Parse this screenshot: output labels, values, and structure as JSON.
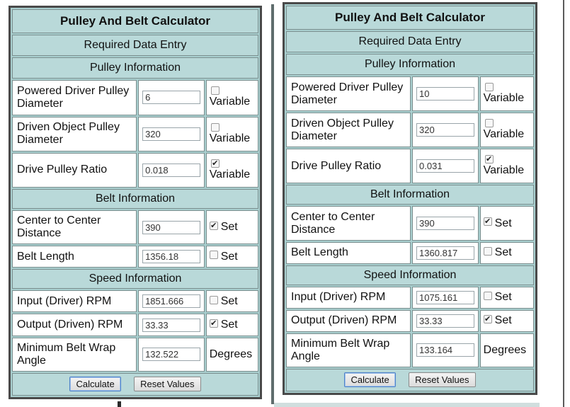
{
  "left": {
    "title": "Pulley And Belt Calculator",
    "required": "Required Data Entry",
    "pulley_section": "Pulley Information",
    "driver_label": "Powered Driver Pulley Diameter",
    "driver_value": "6",
    "driver_option": "Variable",
    "driver_checked": false,
    "driven_label": "Driven Object Pulley Diameter",
    "driven_value": "320",
    "driven_option": "Variable",
    "driven_checked": false,
    "ratio_label": "Drive Pulley Ratio",
    "ratio_value": "0.018",
    "ratio_option": "Variable",
    "ratio_checked": true,
    "belt_section": "Belt Information",
    "center_label": "Center to Center Distance",
    "center_value": "390",
    "center_option": "Set",
    "center_checked": true,
    "length_label": "Belt Length",
    "length_value": "1356.18",
    "length_option": "Set",
    "length_checked": false,
    "speed_section": "Speed Information",
    "input_rpm_label": "Input (Driver) RPM",
    "input_rpm_value": "1851.666",
    "input_rpm_option": "Set",
    "input_rpm_checked": false,
    "output_rpm_label": "Output (Driven) RPM",
    "output_rpm_value": "33.33",
    "output_rpm_option": "Set",
    "output_rpm_checked": true,
    "wrap_label": "Minimum Belt Wrap Angle",
    "wrap_value": "132.522",
    "wrap_unit": "Degrees",
    "calculate": "Calculate",
    "reset": "Reset Values"
  },
  "right": {
    "title": "Pulley And Belt Calculator",
    "required": "Required Data Entry",
    "pulley_section": "Pulley Information",
    "driver_label": "Powered Driver Pulley Diameter",
    "driver_value": "10",
    "driver_option": "Variable",
    "driver_checked": false,
    "driven_label": "Driven Object Pulley Diameter",
    "driven_value": "320",
    "driven_option": "Variable",
    "driven_checked": false,
    "ratio_label": "Drive Pulley Ratio",
    "ratio_value": "0.031",
    "ratio_option": "Variable",
    "ratio_checked": true,
    "belt_section": "Belt Information",
    "center_label": "Center to Center Distance",
    "center_value": "390",
    "center_option": "Set",
    "center_checked": true,
    "length_label": "Belt Length",
    "length_value": "1360.817",
    "length_option": "Set",
    "length_checked": false,
    "speed_section": "Speed Information",
    "input_rpm_label": "Input (Driver) RPM",
    "input_rpm_value": "1075.161",
    "input_rpm_option": "Set",
    "input_rpm_checked": false,
    "output_rpm_label": "Output (Driven) RPM",
    "output_rpm_value": "33.33",
    "output_rpm_option": "Set",
    "output_rpm_checked": true,
    "wrap_label": "Minimum Belt Wrap Angle",
    "wrap_value": "133.164",
    "wrap_unit": "Degrees",
    "calculate": "Calculate",
    "reset": "Reset Values"
  }
}
